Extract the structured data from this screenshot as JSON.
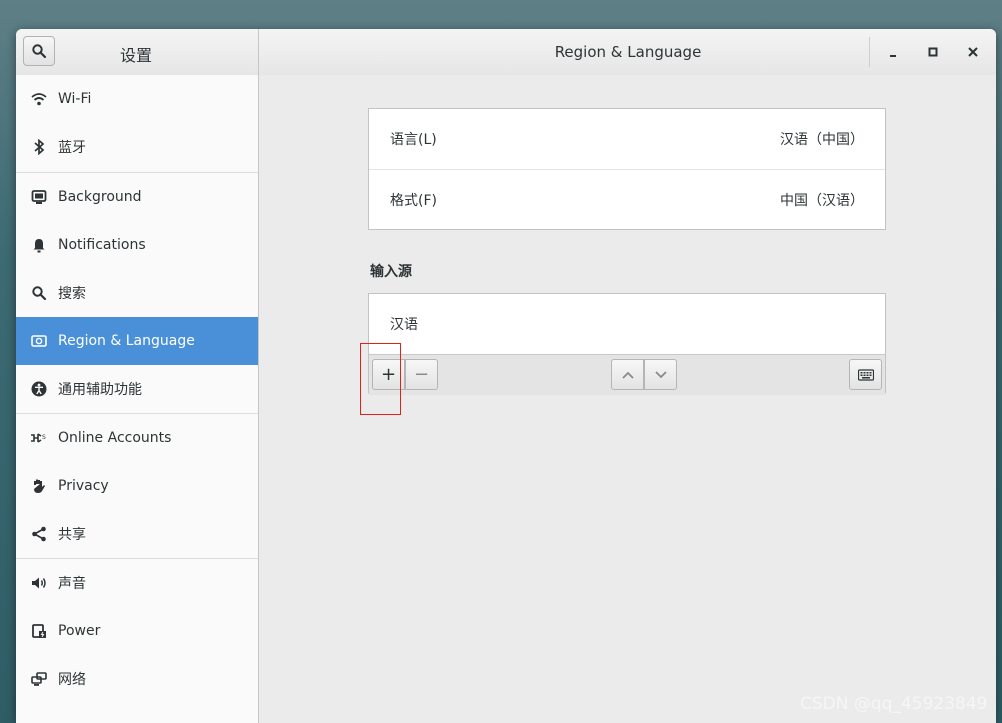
{
  "window": {
    "sidebar_title": "设置",
    "main_title": "Region & Language"
  },
  "sidebar": {
    "items": [
      {
        "label": "Wi-Fi",
        "icon": "wifi-icon"
      },
      {
        "label": "蓝牙",
        "icon": "bluetooth-icon"
      },
      {
        "label": "Background",
        "icon": "background-icon"
      },
      {
        "label": "Notifications",
        "icon": "bell-icon"
      },
      {
        "label": "搜索",
        "icon": "search-icon"
      },
      {
        "label": "Region & Language",
        "icon": "region-icon",
        "selected": true
      },
      {
        "label": "通用辅助功能",
        "icon": "accessibility-icon"
      },
      {
        "label": "Online Accounts",
        "icon": "online-accounts-icon"
      },
      {
        "label": "Privacy",
        "icon": "hand-icon"
      },
      {
        "label": "共享",
        "icon": "share-icon"
      },
      {
        "label": "声音",
        "icon": "speaker-icon"
      },
      {
        "label": "Power",
        "icon": "power-icon"
      },
      {
        "label": "网络",
        "icon": "network-icon"
      }
    ]
  },
  "region": {
    "language_label": "语言(L)",
    "language_value": "汉语（中国）",
    "format_label": "格式(F)",
    "format_value": "中国（汉语）"
  },
  "input_sources": {
    "title": "输入源",
    "items": [
      "汉语"
    ],
    "add_label": "+",
    "remove_label": "−"
  },
  "watermark": "CSDN @qq_45923849",
  "colors": {
    "accent": "#4a90d9",
    "highlight_box": "#e0201b"
  }
}
